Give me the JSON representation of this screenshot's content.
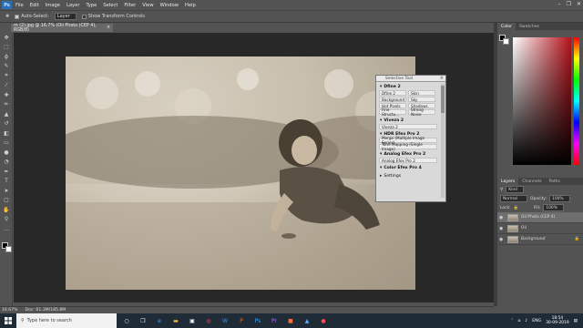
{
  "menubar": {
    "logo": "Ps",
    "items": [
      "File",
      "Edit",
      "Image",
      "Layer",
      "Type",
      "Select",
      "Filter",
      "View",
      "Window",
      "Help"
    ]
  },
  "options": {
    "auto_select_label": "Auto-Select:",
    "auto_select_value": "Layer",
    "transform_label": "Show Transform Controls"
  },
  "document": {
    "tab_title": "m (2).jpg @ 16.7% (Oil Photo (CEP 4), RGB/8)"
  },
  "status": {
    "zoom": "16.67%",
    "doc": "Doc: 61.3M/185.8M"
  },
  "panels": {
    "color_tabs": [
      "Color",
      "Swatches"
    ],
    "layer_tabs": [
      "Layers",
      "Channels",
      "Paths"
    ],
    "kind_label": "Kind",
    "blend_mode": "Normal",
    "opacity_label": "Opacity:",
    "opacity_value": "100%",
    "lock_label": "Lock:",
    "fill_label": "Fill:",
    "fill_value": "100%",
    "layers": [
      {
        "name": "Oil Photo (CEP 4)",
        "active": true
      },
      {
        "name": "Oil",
        "active": false
      },
      {
        "name": "Background",
        "active": false
      }
    ]
  },
  "selective_tool": {
    "title": "Selective Tool",
    "sections": [
      {
        "name": "Dfine 2",
        "grid": [
          "Dfine 2",
          "Skin",
          "Background",
          "Sky",
          "Hot Pixels",
          "Shadows",
          "Fine Structu...",
          "Strong Noise"
        ],
        "rows": []
      },
      {
        "name": "Viveza 2",
        "grid": [],
        "rows": [
          "Viveza 2"
        ]
      },
      {
        "name": "HDR Efex Pro 2",
        "grid": [],
        "rows": [
          "Merge (Multiple Image Series)",
          "Tone Mapping (Single Image)"
        ]
      },
      {
        "name": "Analog Efex Pro 2",
        "grid": [],
        "rows": [
          "Analog Efex Pro 2"
        ]
      },
      {
        "name": "Color Efex Pro 4",
        "grid": [],
        "rows": []
      },
      {
        "name": "Settings",
        "grid": [],
        "rows": []
      }
    ]
  },
  "taskbar": {
    "search_placeholder": "Type here to search",
    "language": "ENG",
    "time": "18:54",
    "date": "30-09-2019"
  },
  "colors": {
    "ps_blue": "#2d6fb5",
    "panel_gray": "#535353",
    "canvas_dark": "#282828",
    "taskbar": "#1f2c38"
  }
}
